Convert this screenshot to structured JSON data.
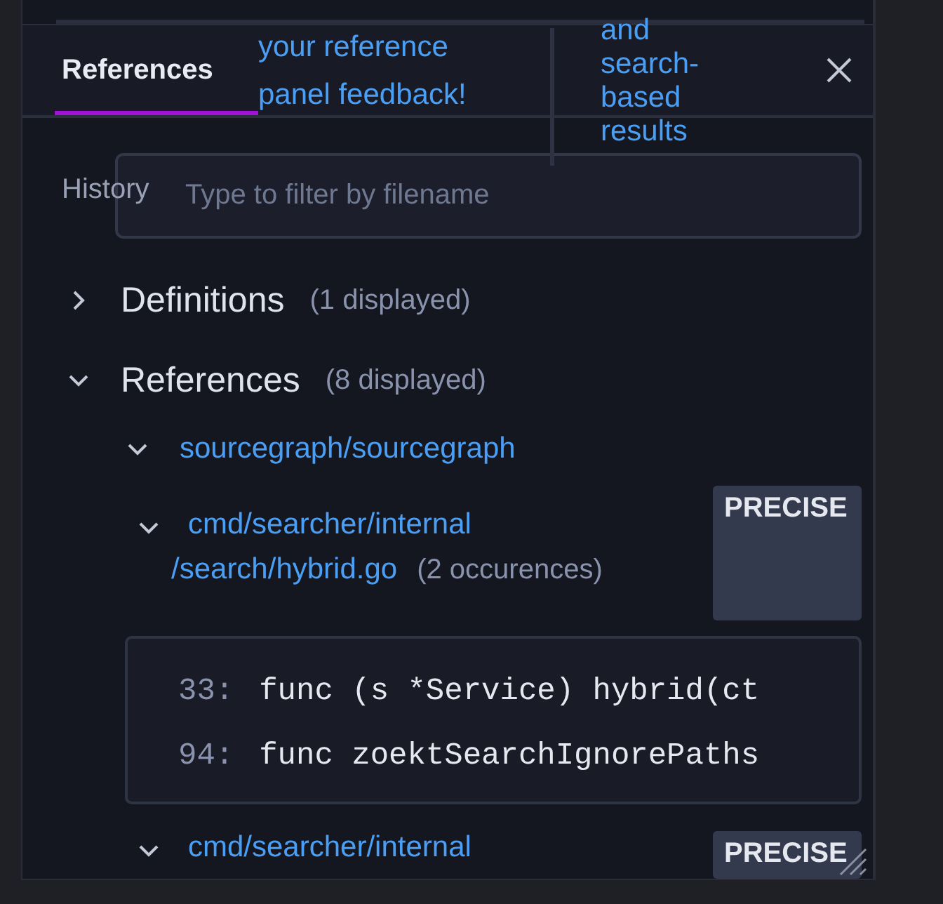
{
  "tabs": [
    {
      "label": "References",
      "selected": true
    },
    {
      "label": "History",
      "selected": false
    }
  ],
  "overlay_texts": [
    "your reference panel feedback!",
    "and search-based results"
  ],
  "filter": {
    "placeholder": "Type to filter by filename"
  },
  "groups": [
    {
      "title": "Definitions",
      "count": "(1 displayed)",
      "expanded": false
    },
    {
      "title": "References",
      "count": "(8 displayed)",
      "expanded": true,
      "repos": [
        {
          "name": "sourcegraph/sourcegraph",
          "expanded": true,
          "files": [
            {
              "path_lines": [
                "cmd/searcher/internal",
                "/search/hybrid.go"
              ],
              "count": "(2 occurences)",
              "badge": "PRECISE",
              "expanded": true,
              "lines": [
                {
                  "number": "33:",
                  "code": "func (s *Service) hybrid(ct"
                },
                {
                  "number": "94:",
                  "code": "func zoektSearchIgnorePaths"
                }
              ]
            },
            {
              "path_lines": [
                "cmd/searcher/internal"
              ],
              "badge": "PRECISE",
              "expanded": true
            }
          ]
        }
      ]
    }
  ]
}
